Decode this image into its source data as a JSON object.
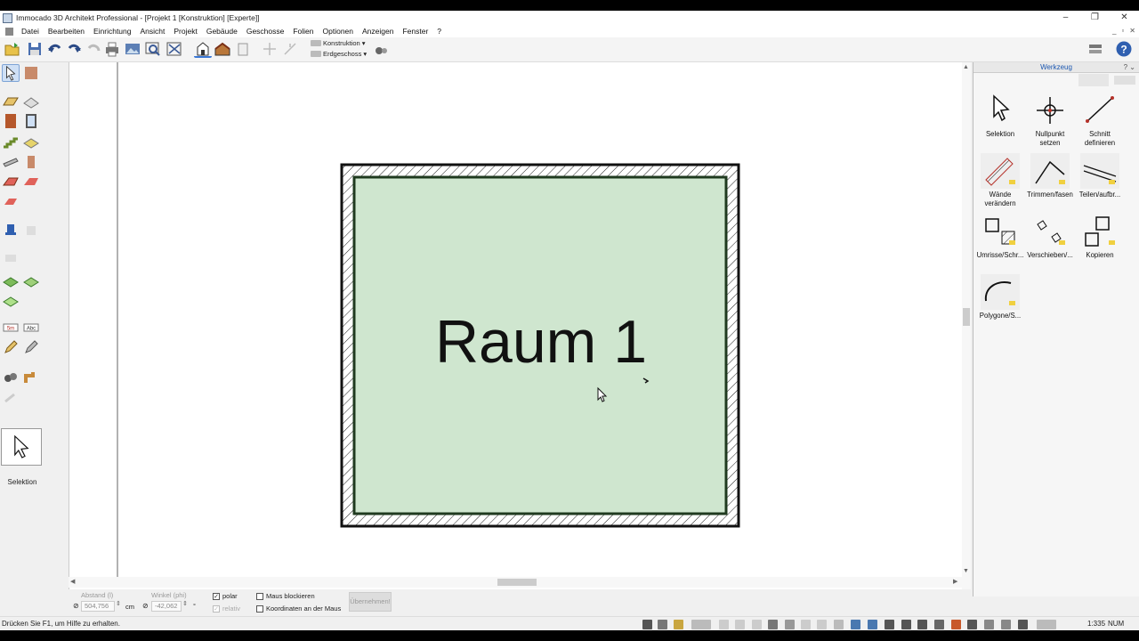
{
  "window": {
    "title": "Immocado 3D Architekt Professional - [Projekt 1 [Konstruktion] [Experte]]",
    "controls": [
      "–",
      "❐",
      "✕"
    ]
  },
  "menu": {
    "items": [
      "Datei",
      "Bearbeiten",
      "Einrichtung",
      "Ansicht",
      "Projekt",
      "Gebäude",
      "Geschosse",
      "Folien",
      "Optionen",
      "Anzeigen",
      "Fenster",
      "?"
    ]
  },
  "toolbar": {
    "view_mode": "Konstruktion",
    "floor": "Erdgeschoss"
  },
  "left_tools": {
    "current_tool_label": "Selektion"
  },
  "canvas": {
    "room_label": "Raum 1",
    "room_fill": "#cfe6cf",
    "wall_color": "#1d1d1d"
  },
  "tool_panel": {
    "title": "Werkzeug",
    "tools": [
      {
        "label": "Selektion"
      },
      {
        "label": "Nullpunkt setzen"
      },
      {
        "label": "Schnitt definieren"
      },
      {
        "label": "Wände verändern"
      },
      {
        "label": "Trimmen/fasen"
      },
      {
        "label": "Teilen/aufbr..."
      },
      {
        "label": "Umrisse/Schr..."
      },
      {
        "label": "Verschieben/..."
      },
      {
        "label": "Kopieren"
      },
      {
        "label": "Polygone/S..."
      }
    ]
  },
  "input_bar": {
    "distance_label": "Abstand (l)",
    "distance_value": "504,756",
    "distance_unit": "cm",
    "angle_label": "Winkel (phi)",
    "angle_value": "-42,062",
    "angle_unit": "°",
    "polar_label": "polar",
    "polar_checked": "✓",
    "relative_label": "relativ",
    "relative_checked": "✓",
    "block_mouse_label": "Maus blockieren",
    "coords_label": "Koordinaten an der Maus",
    "apply_label": "Übernehmen!"
  },
  "status_bar": {
    "hint": "Drücken Sie F1, um Hilfe zu erhalten.",
    "scale": "1:335",
    "num": "NUM"
  }
}
